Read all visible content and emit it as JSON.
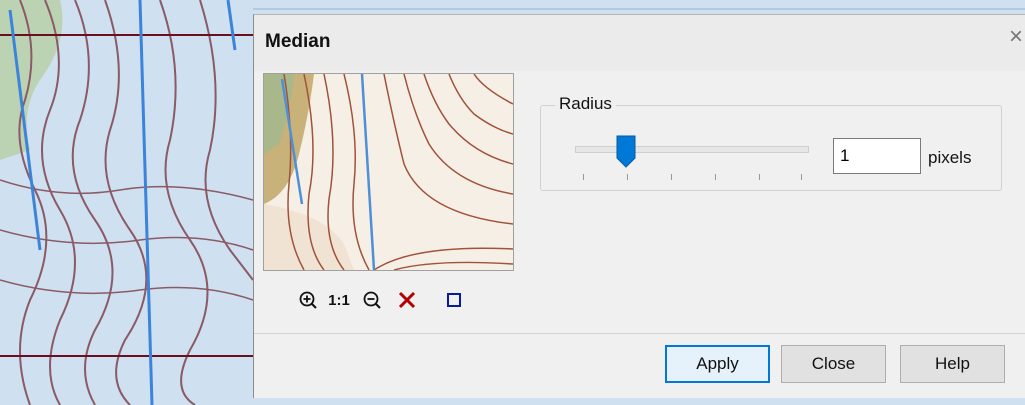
{
  "dialog": {
    "title": "Median",
    "close_glyph": "×"
  },
  "preview": {
    "image": "topographic-map-preview"
  },
  "toolbar": {
    "zoom_in_icon": "zoom-in-icon",
    "one_to_one_label": "1:1",
    "zoom_out_icon": "zoom-out-icon",
    "clear_icon": "clear-icon",
    "fit_icon": "fit-to-window-icon"
  },
  "radius": {
    "group_label": "Radius",
    "value": "1",
    "units": "pixels",
    "slider_value_fraction": 0.2
  },
  "buttons": {
    "apply": "Apply",
    "close": "Close",
    "help": "Help"
  },
  "colors": {
    "accent": "#0078d7",
    "clear_icon": "#b30000",
    "fit_icon": "#0a1a9e"
  }
}
